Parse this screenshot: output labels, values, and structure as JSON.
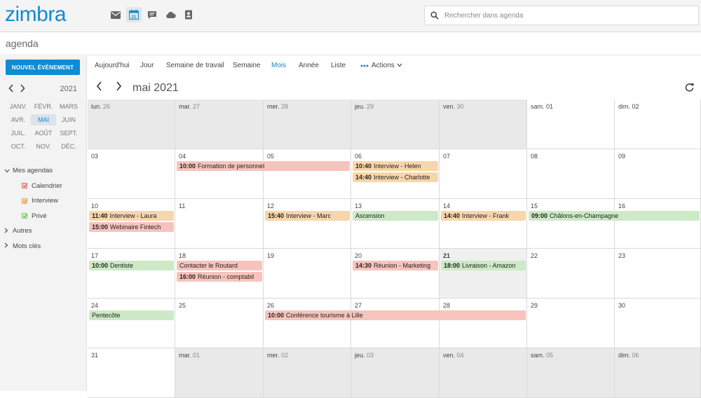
{
  "app": {
    "logo": "zimbra",
    "search_placeholder": "Rechercher dans agenda",
    "page_title": "agenda",
    "nav_icons": [
      "mail-icon",
      "calendar-icon",
      "chat-icon",
      "cloud-icon",
      "contacts-icon"
    ],
    "nav_icon_day": "21"
  },
  "colors": {
    "brand": "#0f8cd4",
    "event_red": "#f6c4bd",
    "event_orange": "#f8d6ab",
    "event_green": "#cde9c6"
  },
  "sidebar": {
    "new_event": "NOUVEL ÉVÉNEMENT",
    "year": "2021",
    "months": [
      "JANV.",
      "FÉVR.",
      "MARS",
      "AVR.",
      "MAI",
      "JUIN",
      "JUIL.",
      "AOÛT",
      "SEPT.",
      "OCT.",
      "NOV.",
      "DÉC."
    ],
    "selected_month": "MAI",
    "tree": {
      "my_calendars": "Mes agendas",
      "calendars": [
        {
          "label": "Calendrier",
          "color": "#e0726a"
        },
        {
          "label": "Interview",
          "color": "#e8a55a"
        },
        {
          "label": "Privé",
          "color": "#7cc26c"
        }
      ],
      "others": "Autres",
      "tags": "Mots clés"
    }
  },
  "toolbar": {
    "today": "Aujourd'hui",
    "day": "Jour",
    "work_week": "Semaine de travail",
    "week": "Semaine",
    "month": "Mois",
    "year": "Année",
    "list": "Liste",
    "actions": "Actions"
  },
  "calendar": {
    "title": "mai 2021",
    "rows": [
      [
        "lun. 26",
        "mar. 27",
        "mer. 28",
        "jeu. 29",
        "ven. 30",
        "sam. 01",
        "dim. 02"
      ],
      [
        "03",
        "04",
        "05",
        "06",
        "07",
        "08",
        "09"
      ],
      [
        "10",
        "11",
        "12",
        "13",
        "14",
        "15",
        "16"
      ],
      [
        "17",
        "18",
        "19",
        "20",
        "21",
        "22",
        "23"
      ],
      [
        "24",
        "25",
        "26",
        "27",
        "28",
        "29",
        "30"
      ],
      [
        "31",
        "mar. 01",
        "mer. 02",
        "jeu. 03",
        "ven. 04",
        "sam. 05",
        "dim. 06"
      ]
    ],
    "events": [
      {
        "row": 1,
        "col": 1,
        "span": 2,
        "slot": 0,
        "time": "10:00",
        "title": "Formation de personnel",
        "color": "red"
      },
      {
        "row": 1,
        "col": 3,
        "span": 1,
        "slot": 0,
        "time": "10:40",
        "title": "Interview - Helen",
        "color": "org"
      },
      {
        "row": 1,
        "col": 3,
        "span": 1,
        "slot": 1,
        "time": "14:40",
        "title": "Interview - Charlotte",
        "color": "org"
      },
      {
        "row": 2,
        "col": 0,
        "span": 1,
        "slot": 0,
        "time": "11:40",
        "title": "Interview - Laura",
        "color": "org"
      },
      {
        "row": 2,
        "col": 0,
        "span": 1,
        "slot": 1,
        "time": "15:00",
        "title": "Webinaire Fintech",
        "color": "red"
      },
      {
        "row": 2,
        "col": 2,
        "span": 1,
        "slot": 0,
        "time": "15:40",
        "title": "Interview - Marc",
        "color": "org"
      },
      {
        "row": 2,
        "col": 3,
        "span": 1,
        "slot": 0,
        "time": "",
        "title": "Ascension",
        "color": "grn"
      },
      {
        "row": 2,
        "col": 4,
        "span": 1,
        "slot": 0,
        "time": "14:40",
        "title": "Interview - Frank",
        "color": "org"
      },
      {
        "row": 2,
        "col": 5,
        "span": 2,
        "slot": 0,
        "time": "09:00",
        "title": "Châlons-en-Champagne",
        "color": "grn"
      },
      {
        "row": 3,
        "col": 0,
        "span": 1,
        "slot": 0,
        "time": "10:00",
        "title": "Dentiste",
        "color": "grn"
      },
      {
        "row": 3,
        "col": 1,
        "span": 1,
        "slot": 0,
        "time": "",
        "title": "Contacter le Routard",
        "color": "red"
      },
      {
        "row": 3,
        "col": 1,
        "span": 1,
        "slot": 1,
        "time": "16:00",
        "title": "Réunion - comptabil",
        "color": "red"
      },
      {
        "row": 3,
        "col": 3,
        "span": 1,
        "slot": 0,
        "time": "14:30",
        "title": "Réunion - Marketing",
        "color": "red"
      },
      {
        "row": 3,
        "col": 4,
        "span": 1,
        "slot": 0,
        "time": "18:00",
        "title": "Livraison - Amazon",
        "color": "grn"
      },
      {
        "row": 4,
        "col": 0,
        "span": 1,
        "slot": 0,
        "time": "",
        "title": "Pentecôte",
        "color": "grn"
      },
      {
        "row": 4,
        "col": 2,
        "span": 3,
        "slot": 0,
        "time": "10:00",
        "title": "Conférence tourisme à Lille",
        "color": "red"
      }
    ]
  }
}
